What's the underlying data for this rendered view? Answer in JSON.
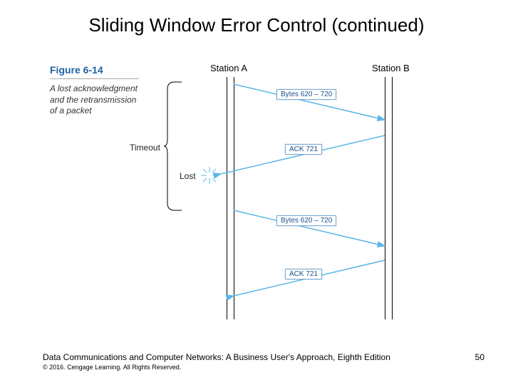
{
  "title": "Sliding Window Error Control (continued)",
  "figure": {
    "number": "Figure 6-14",
    "caption": "A lost acknowledgment and the retransmission of a packet",
    "stationA": "Station A",
    "stationB": "Station B",
    "timeout": "Timeout",
    "lost": "Lost",
    "messages": {
      "data1": "Bytes 620 – 720",
      "ack1": "ACK 721",
      "data2": "Bytes 620 – 720",
      "ack2": "ACK 721"
    }
  },
  "footer": {
    "main": "Data Communications and Computer Networks: A Business User's Approach, Eighth Edition",
    "sub": "© 2016. Cengage Learning. All Rights Reserved.",
    "page": "50"
  },
  "colors": {
    "arrow": "#5bb6e6",
    "figNumber": "#1e63a3",
    "boxBorder": "#7aa8d6",
    "boxText": "#1a4f87"
  }
}
